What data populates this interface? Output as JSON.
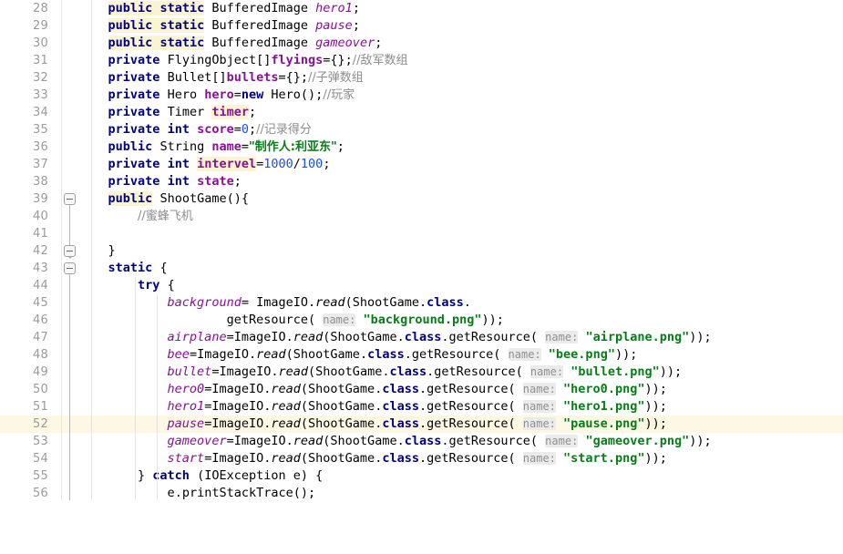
{
  "editor": {
    "app": "intellij-idea-java-editor",
    "language": "Java",
    "first_line": 28,
    "last_line": 56,
    "current_line": 52,
    "colors": {
      "background": "#ffffff",
      "gutter_text": "#999b9e",
      "keyword": "#000080",
      "string": "#067d17",
      "number": "#1750eb",
      "comment": "#8c8c8c",
      "static_field": "#871094",
      "instance_field": "#871094",
      "param_hint_bg": "#ebebeb",
      "identifier_highlight": "#faf4d2",
      "current_line_bg": "#fdf8e3",
      "indent_guide": "#e3e3e3"
    }
  },
  "lines": [
    {
      "n": "28",
      "text": "        public static BufferedImage hero1;"
    },
    {
      "n": "29",
      "text": "        public static BufferedImage pause;"
    },
    {
      "n": "30",
      "text": "        public static BufferedImage gameover;"
    },
    {
      "n": "31",
      "text": "        private FlyingObject[]flyings={};//敌军数组"
    },
    {
      "n": "32",
      "text": "        private Bullet[]bullets={};//子弹数组"
    },
    {
      "n": "33",
      "text": "        private Hero hero=new Hero();//玩家"
    },
    {
      "n": "34",
      "text": "        private Timer timer;"
    },
    {
      "n": "35",
      "text": "        private int score=0;//记录得分"
    },
    {
      "n": "36",
      "text": "        public String name=\"制作人:利亚东\";"
    },
    {
      "n": "37",
      "text": "        private int intervel=1000/100;"
    },
    {
      "n": "38",
      "text": "        private int state;"
    },
    {
      "n": "39",
      "text": "        public ShootGame(){"
    },
    {
      "n": "40",
      "text": "            //蜜蜂飞机"
    },
    {
      "n": "41",
      "text": ""
    },
    {
      "n": "42",
      "text": "        }"
    },
    {
      "n": "43",
      "text": "        static {"
    },
    {
      "n": "44",
      "text": "            try {"
    },
    {
      "n": "45",
      "text": "                background= ImageIO.read(ShootGame.class."
    },
    {
      "n": "46",
      "text": "                        getResource( name: \"background.png\"));"
    },
    {
      "n": "47",
      "text": "                airplane=ImageIO.read(ShootGame.class.getResource( name: \"airplane.png\"));"
    },
    {
      "n": "48",
      "text": "                bee=ImageIO.read(ShootGame.class.getResource( name: \"bee.png\"));"
    },
    {
      "n": "49",
      "text": "                bullet=ImageIO.read(ShootGame.class.getResource( name: \"bullet.png\"));"
    },
    {
      "n": "50",
      "text": "                hero0=ImageIO.read(ShootGame.class.getResource( name: \"hero0.png\"));"
    },
    {
      "n": "51",
      "text": "                hero1=ImageIO.read(ShootGame.class.getResource( name: \"hero1.png\"));"
    },
    {
      "n": "52",
      "text": "                pause=ImageIO.read(ShootGame.class.getResource( name: \"pause.png\"));"
    },
    {
      "n": "53",
      "text": "                gameover=ImageIO.read(ShootGame.class.getResource( name: \"gameover.png\"));"
    },
    {
      "n": "54",
      "text": "                start=ImageIO.read(ShootGame.class.getResource( name: \"start.png\"));"
    },
    {
      "n": "55",
      "text": "            } catch (IOException e) {"
    },
    {
      "n": "56",
      "text": "                e.printStackTrace();"
    }
  ],
  "tokens": {
    "kw_public": "public",
    "kw_private": "private",
    "kw_static": "static",
    "kw_new": "new",
    "kw_int": "int",
    "kw_try": "try",
    "kw_catch": "catch",
    "type_buffered_image": "BufferedImage",
    "type_flying_object": "FlyingObject",
    "type_bullet": "Bullet",
    "type_hero": "Hero",
    "type_timer": "Timer",
    "type_string": "String",
    "type_io_exception": "IOException",
    "class_shootgame": "ShootGame",
    "class_imageio": "ImageIO",
    "method_read": "read",
    "method_get_resource": "getResource",
    "method_print_stack_trace": "printStackTrace",
    "kw_class_literal": "class",
    "param_hint_name": "name:",
    "fields": {
      "hero1": "hero1",
      "pause": "pause",
      "gameover": "gameover",
      "flyings": "flyings",
      "bullets": "bullets",
      "hero": "hero",
      "timer": "timer",
      "score": "score",
      "name": "name",
      "intervel": "intervel",
      "state": "state",
      "background": "background",
      "airplane": "airplane",
      "bee": "bee",
      "bullet": "bullet",
      "hero0": "hero0",
      "start": "start",
      "e": "e"
    },
    "strings": {
      "producer_name": "\"制作人:利亚东\"",
      "background_png": "\"background.png\"",
      "airplane_png": "\"airplane.png\"",
      "bee_png": "\"bee.png\"",
      "bullet_png": "\"bullet.png\"",
      "hero0_png": "\"hero0.png\"",
      "hero1_png": "\"hero1.png\"",
      "pause_png": "\"pause.png\"",
      "gameover_png": "\"gameover.png\"",
      "start_png": "\"start.png\""
    },
    "comments": {
      "enemy_array": "//敌军数组",
      "bullet_array": "//子弹数组",
      "player": "//玩家",
      "record_score": "//记录得分",
      "bee_plane": "//蜜蜂飞机"
    },
    "numbers": {
      "zero": "0",
      "thousand": "1000",
      "hundred": "100"
    }
  },
  "gutter": {
    "line_numbers": [
      "28",
      "29",
      "30",
      "31",
      "32",
      "33",
      "34",
      "35",
      "36",
      "37",
      "38",
      "39",
      "40",
      "41",
      "42",
      "43",
      "44",
      "45",
      "46",
      "47",
      "48",
      "49",
      "50",
      "51",
      "52",
      "53",
      "54",
      "55",
      "56"
    ],
    "fold_regions": [
      {
        "label": "fold-constructor-39",
        "start_line": "39",
        "end_line": "42"
      },
      {
        "label": "fold-static-block-43",
        "start_line": "43",
        "end_line": "56"
      }
    ]
  }
}
